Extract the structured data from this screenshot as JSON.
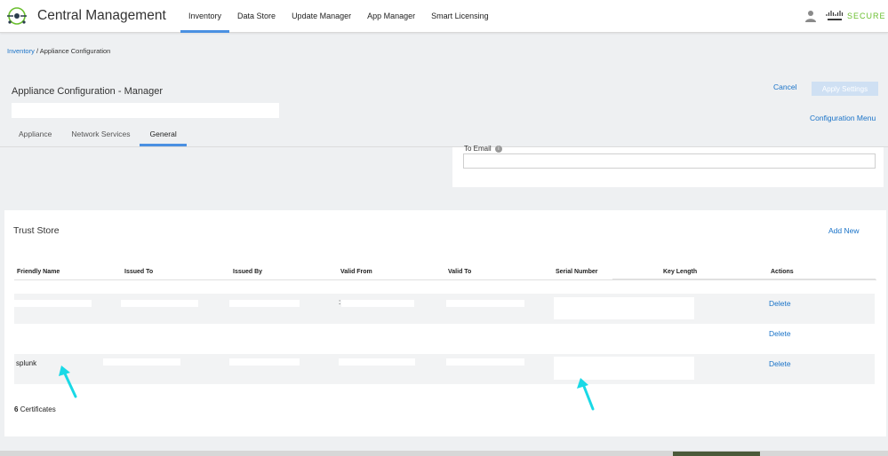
{
  "app": {
    "title": "Central Management",
    "brand_suffix": "SECURE",
    "brand_color": "#6abf2e",
    "accent_color": "#4a90e2",
    "link_color": "#1a73c8"
  },
  "nav": {
    "items": [
      {
        "label": "Inventory",
        "active": true
      },
      {
        "label": "Data Store",
        "active": false
      },
      {
        "label": "Update Manager",
        "active": false
      },
      {
        "label": "App Manager",
        "active": false
      },
      {
        "label": "Smart Licensing",
        "active": false
      }
    ],
    "user_icon": "user-icon",
    "logo_icon": "cisco-logo-icon"
  },
  "breadcrumb": {
    "root": "Inventory",
    "separator": "/",
    "current": "Appliance Configuration"
  },
  "header": {
    "title": "Appliance Configuration - Manager",
    "cancel_label": "Cancel",
    "apply_label": "Apply Settings",
    "config_menu_label": "Configuration Menu"
  },
  "tabs": [
    {
      "label": "Appliance",
      "active": false
    },
    {
      "label": "Network Services",
      "active": false
    },
    {
      "label": "General",
      "active": true
    }
  ],
  "email_panel": {
    "label": "To Email",
    "info_icon": "info-icon",
    "value": ""
  },
  "trust_store": {
    "title": "Trust Store",
    "add_new_label": "Add New",
    "columns": [
      "Friendly Name",
      "Issued To",
      "Issued By",
      "Valid From",
      "Valid To",
      "Serial Number",
      "Key Length",
      "Actions"
    ],
    "rows": [
      {
        "friendly_name": "",
        "valid_from_fragment": ":",
        "action": "Delete"
      },
      {
        "friendly_name": "",
        "valid_from_fragment": "",
        "action": "Delete"
      },
      {
        "friendly_name": "splunk",
        "valid_from_fragment": "",
        "action": "Delete"
      }
    ],
    "count_number": "6",
    "count_label": "Certificates"
  },
  "annotations": {
    "arrow_color": "#19d9e6"
  }
}
